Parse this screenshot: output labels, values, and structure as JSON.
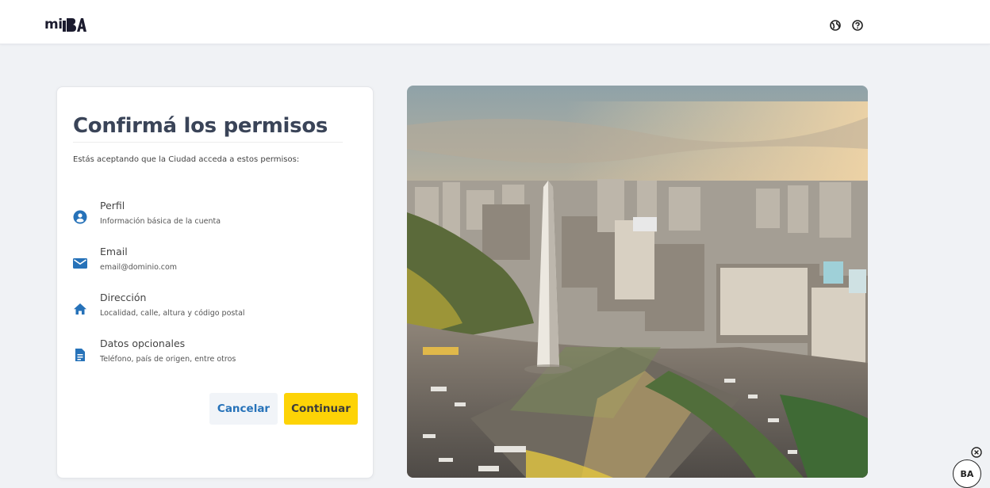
{
  "header": {
    "logo_text": "mi",
    "logo_mark": "BA",
    "icons": [
      "globe-icon",
      "help-icon"
    ]
  },
  "card": {
    "title": "Confirmá los permisos",
    "subtitle": "Estás aceptando que la Ciudad acceda a estos permisos:",
    "permissions": [
      {
        "icon": "user-icon",
        "label": "Perfil",
        "description": "Información básica de la cuenta"
      },
      {
        "icon": "email-icon",
        "label": "Email",
        "description": "email@dominio.com"
      },
      {
        "icon": "home-icon",
        "label": "Dirección",
        "description": "Localidad, calle, altura y código postal"
      },
      {
        "icon": "document-icon",
        "label": "Datos opcionales",
        "description": "Teléfono, país de origen, entre otros"
      }
    ],
    "cancel_label": "Cancelar",
    "continue_label": "Continuar"
  },
  "fab": {
    "label": "BA",
    "close_icon": "close-circle-icon"
  },
  "colors": {
    "accent_blue": "#2672b9",
    "primary_yellow": "#fdd306",
    "title_text": "#3a4458",
    "background": "#f0f2f5"
  }
}
